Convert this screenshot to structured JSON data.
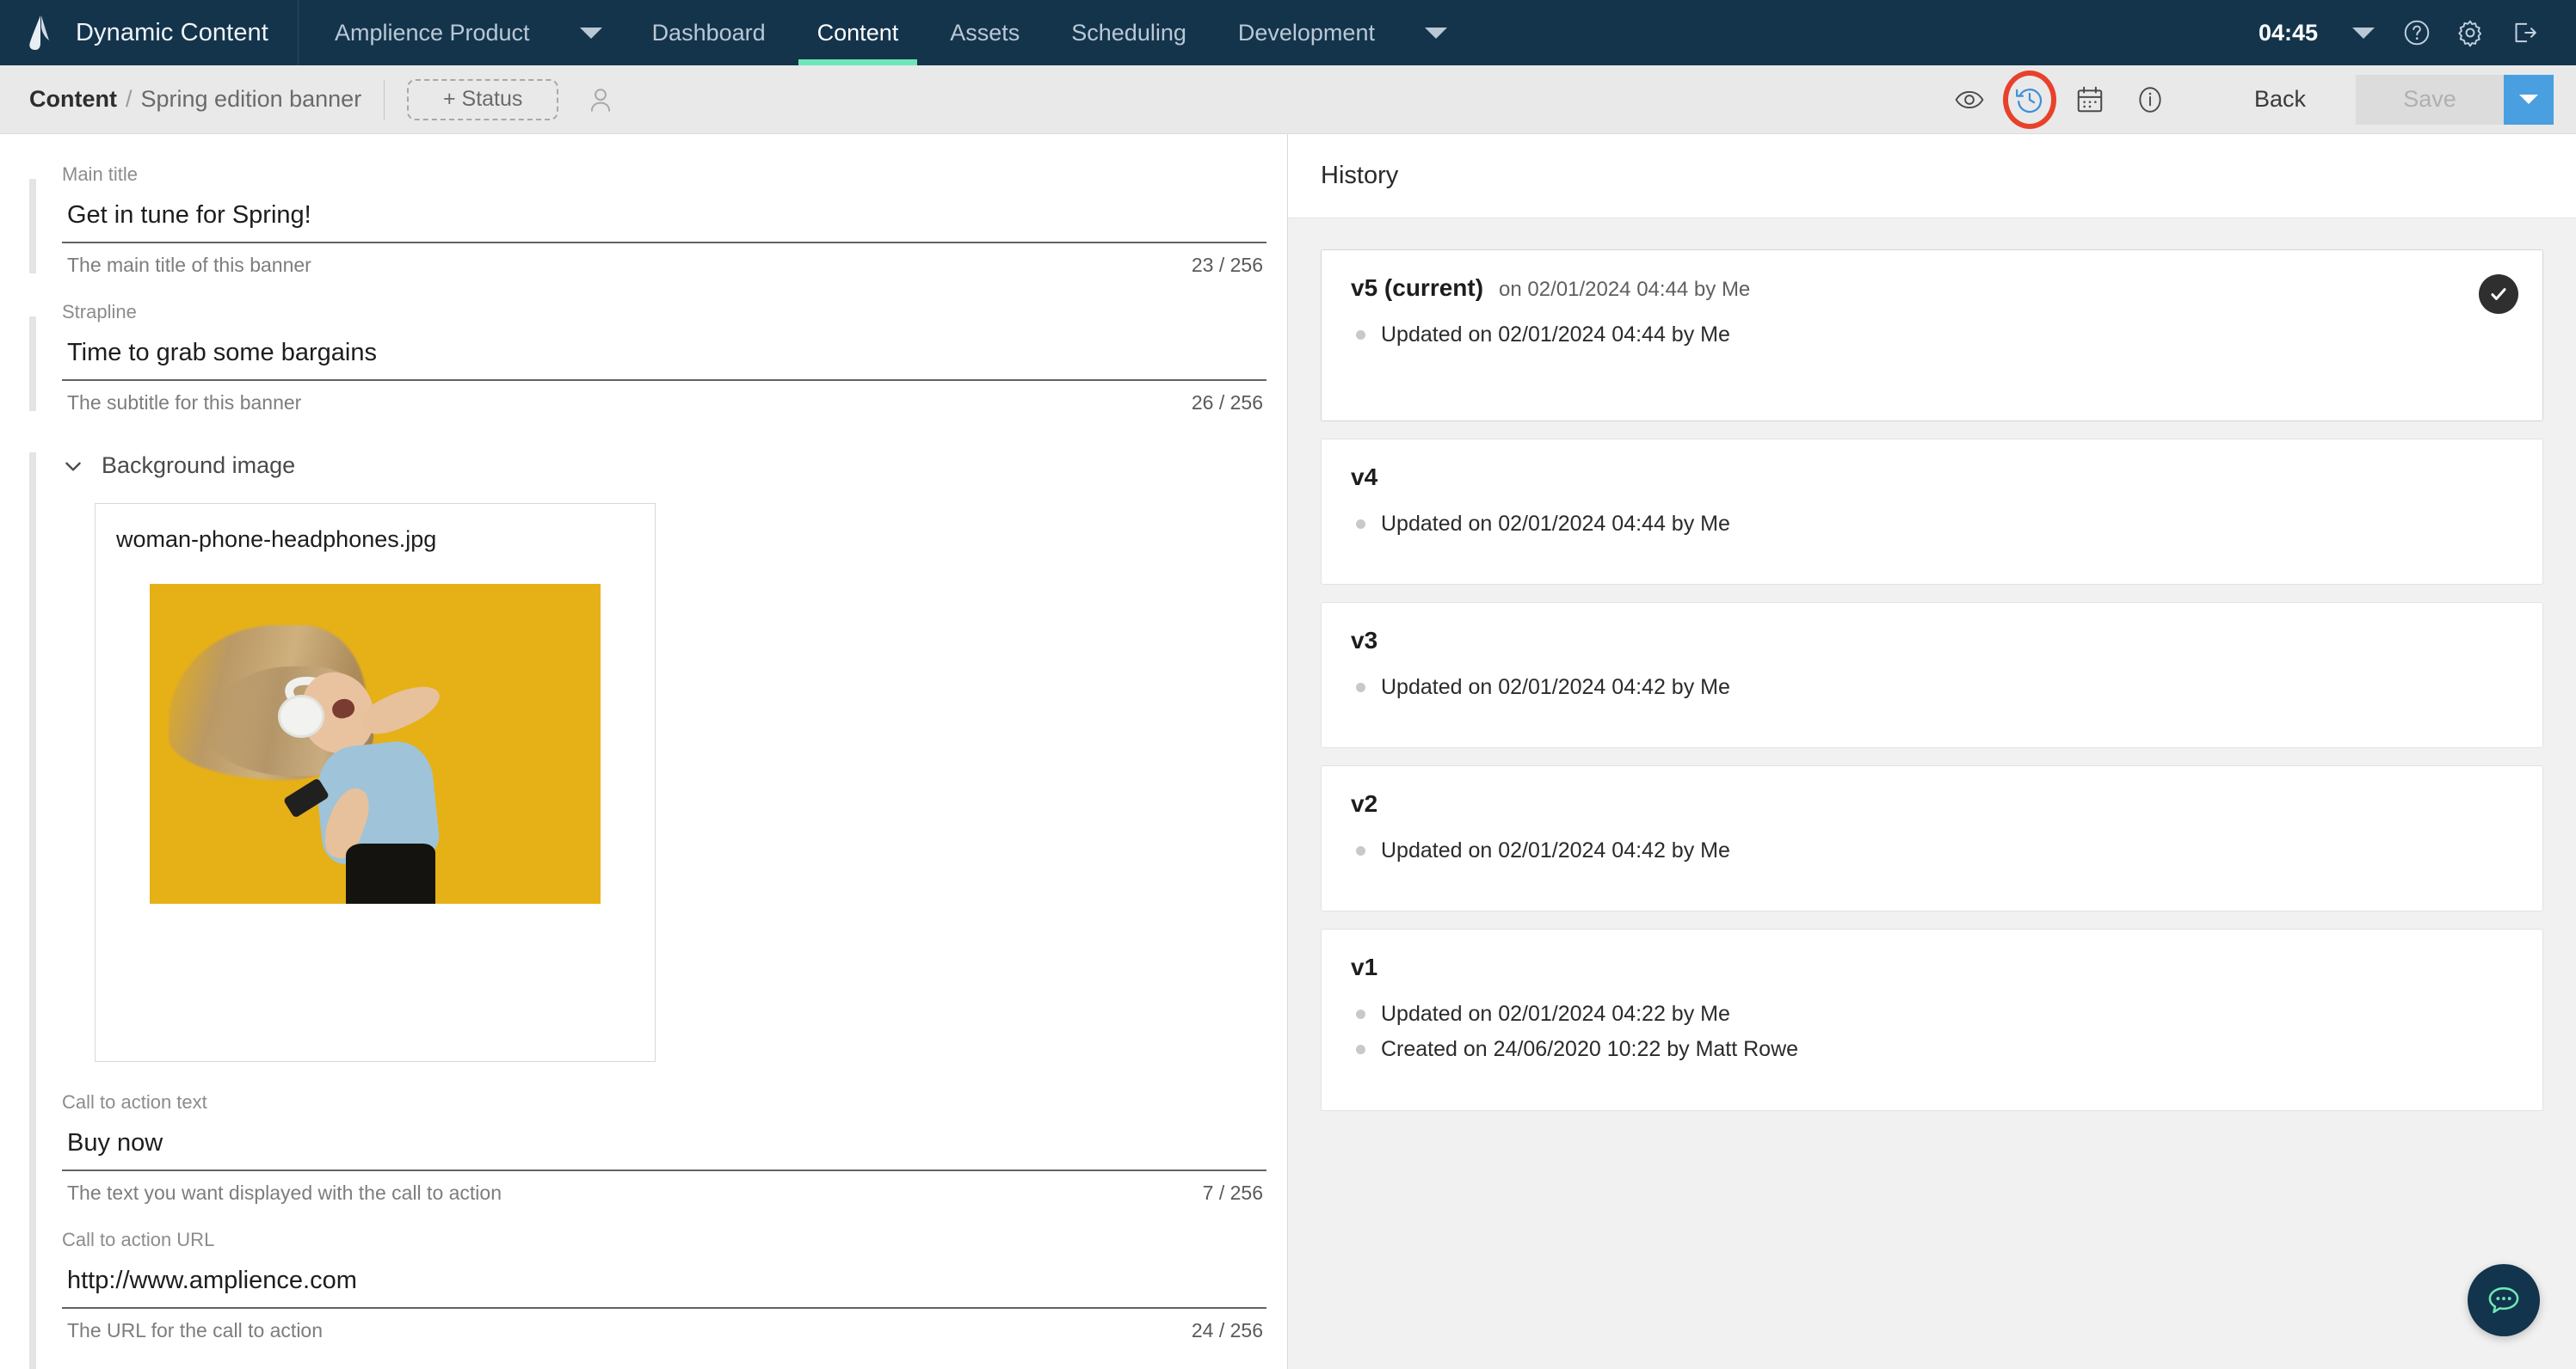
{
  "topnav": {
    "brand": "Dynamic Content",
    "brand_logo_icon": "amplience-logo-icon",
    "account": "Amplience Product",
    "account_caret_icon": "chevron-down-icon",
    "items": [
      {
        "label": "Dashboard",
        "active": false
      },
      {
        "label": "Content",
        "active": true
      },
      {
        "label": "Assets",
        "active": false
      },
      {
        "label": "Scheduling",
        "active": false
      },
      {
        "label": "Development",
        "active": false
      }
    ],
    "dev_caret_icon": "chevron-down-icon",
    "clock": "04:45",
    "clock_caret_icon": "chevron-down-icon",
    "help_icon": "help-circle-icon",
    "settings_icon": "gear-icon",
    "logout_icon": "logout-icon",
    "active_accent": "#6ee7b7",
    "bar_color": "#14344c"
  },
  "toolbar": {
    "breadcrumb_root": "Content",
    "breadcrumb_separator": "/",
    "breadcrumb_leaf": "Spring edition banner",
    "status_button": "+ Status",
    "avatar_icon": "user-avatar-icon",
    "icons": [
      {
        "name": "eye-icon",
        "active": false
      },
      {
        "name": "history-icon",
        "active": true
      },
      {
        "name": "calendar-icon",
        "active": false
      },
      {
        "name": "info-icon",
        "active": false
      }
    ],
    "annotation_color": "#e8412b",
    "back_label": "Back",
    "save_label": "Save",
    "save_caret_icon": "chevron-down-icon",
    "save_disabled": true,
    "save_caret_color": "#4a9fe0"
  },
  "form": {
    "fields": [
      {
        "label": "Main title",
        "value": "Get in tune for Spring!",
        "help": "The main title of this banner",
        "count": "23 / 256"
      },
      {
        "label": "Strapline",
        "value": "Time to grab some bargains",
        "help": "The subtitle for this banner",
        "count": "26 / 256"
      }
    ],
    "background_section": {
      "title": "Background image",
      "chevron_icon": "chevron-down-icon",
      "asset_name": "woman-phone-headphones.jpg",
      "asset_alt": "woman with headphones and phone on yellow background"
    },
    "cta_fields": [
      {
        "label": "Call to action text",
        "value": "Buy now",
        "help": "The text you want displayed with the call to action",
        "count": "7 / 256"
      },
      {
        "label": "Call to action URL",
        "value": "http://www.amplience.com",
        "help": "The URL for the call to action",
        "count": "24 / 256"
      }
    ]
  },
  "history": {
    "title": "History",
    "current_badge_icon": "check-circle-icon",
    "versions": [
      {
        "version": "v5 (current)",
        "meta": "on 02/01/2024 04:44 by Me",
        "is_current": true,
        "entries": [
          "Updated on 02/01/2024 04:44 by Me"
        ]
      },
      {
        "version": "v4",
        "meta": "",
        "is_current": false,
        "entries": [
          "Updated on 02/01/2024 04:44 by Me"
        ]
      },
      {
        "version": "v3",
        "meta": "",
        "is_current": false,
        "entries": [
          "Updated on 02/01/2024 04:42 by Me"
        ]
      },
      {
        "version": "v2",
        "meta": "",
        "is_current": false,
        "entries": [
          "Updated on 02/01/2024 04:42 by Me"
        ]
      },
      {
        "version": "v1",
        "meta": "",
        "is_current": false,
        "entries": [
          "Updated on 02/01/2024 04:22 by Me",
          "Created on 24/06/2020 10:22 by Matt Rowe"
        ]
      }
    ]
  },
  "chat": {
    "icon": "chat-bubble-icon",
    "bg": "#12344c",
    "fg": "#6ee7b7"
  }
}
